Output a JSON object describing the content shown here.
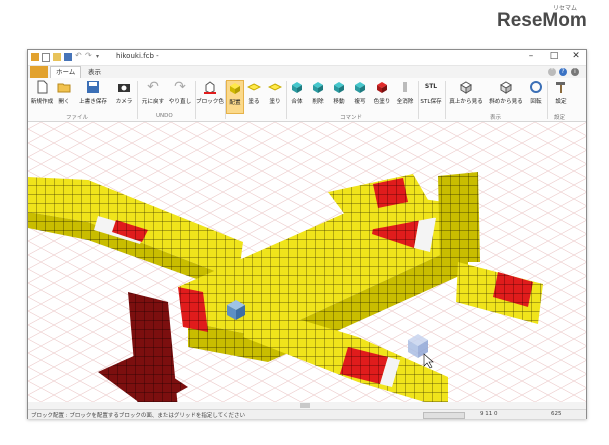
{
  "logo": {
    "text": "ReseMom",
    "ruby": "リセマム"
  },
  "window": {
    "title": "hikouki.fcb -",
    "controls": {
      "minimize": "–",
      "maximize": "□",
      "close": "✕"
    }
  },
  "tabs": {
    "home": "ホーム",
    "view": "表示"
  },
  "ribbon": {
    "groups": {
      "file": "ファイル",
      "undo": "UNDO",
      "command": "コマンド",
      "display": "表示",
      "settings": "設定"
    },
    "buttons": {
      "new": "新規作成",
      "open": "開く",
      "save_as": "上書き保存",
      "camera": "カメラ",
      "undo": "元に戻す",
      "redo": "やり直し",
      "block_color": "ブロック色",
      "place": "配置",
      "paint": "塗る",
      "fill": "塗り",
      "merge": "合体",
      "remove": "削除",
      "move": "移動",
      "copy": "複写",
      "color_all": "色塗り",
      "delete_all": "全消除",
      "stl_save": "STL保存",
      "view_top": "真上から見る",
      "view_side": "斜めから見る",
      "rotate": "回転",
      "settings": "設定"
    },
    "stl_icon_text": "STL"
  },
  "status": {
    "message": "ブロック配置 : ブロックを配置するブロックの面、またはグリッドを指定してください",
    "coords": "9  11  0",
    "zoom": "625"
  },
  "colors": {
    "yellow": "#f0e41b",
    "red": "#e01c1c",
    "dark_red": "#7c0f0f",
    "white": "#f4f4f4",
    "grid": "#ecc8c8"
  }
}
